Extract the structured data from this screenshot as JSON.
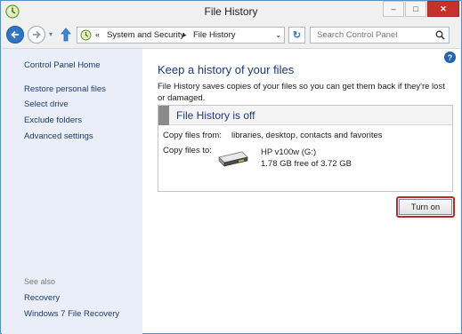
{
  "window": {
    "title": "File History",
    "controls": {
      "minimize": "–",
      "maximize": "□",
      "close": "✕"
    }
  },
  "navbar": {
    "back_icon": "back-arrow-icon",
    "forward_icon": "forward-arrow-icon",
    "up_icon": "up-arrow-icon",
    "address": {
      "overflow": "«",
      "segments": [
        "System and Security",
        "File History"
      ],
      "separator": "▸",
      "dropdown": "⌄"
    },
    "refresh_glyph": "↻",
    "search": {
      "placeholder": "Search Control Panel"
    }
  },
  "sidebar": {
    "items": [
      {
        "label": "Control Panel Home"
      },
      {
        "label": "Restore personal files"
      },
      {
        "label": "Select drive"
      },
      {
        "label": "Exclude folders"
      },
      {
        "label": "Advanced settings"
      }
    ],
    "see_also_label": "See also",
    "see_also_items": [
      {
        "label": "Recovery"
      },
      {
        "label": "Windows 7 File Recovery"
      }
    ]
  },
  "main": {
    "help": "?",
    "heading": "Keep a history of your files",
    "description": "File History saves copies of your files so you can get them back if they're lost or damaged.",
    "status_title": "File History is off",
    "copy_from_label": "Copy files from:",
    "copy_from_value": "libraries, desktop, contacts and favorites",
    "copy_to_label": "Copy files to:",
    "drive_name": "HP v100w (G:)",
    "drive_space": "1.78 GB free of 3.72 GB",
    "turn_on_label": "Turn on"
  },
  "colors": {
    "accent": "#2f76c5",
    "heading": "#1e3a7b",
    "sidebar_bg": "#e9eef8",
    "highlight": "#c0272d"
  }
}
